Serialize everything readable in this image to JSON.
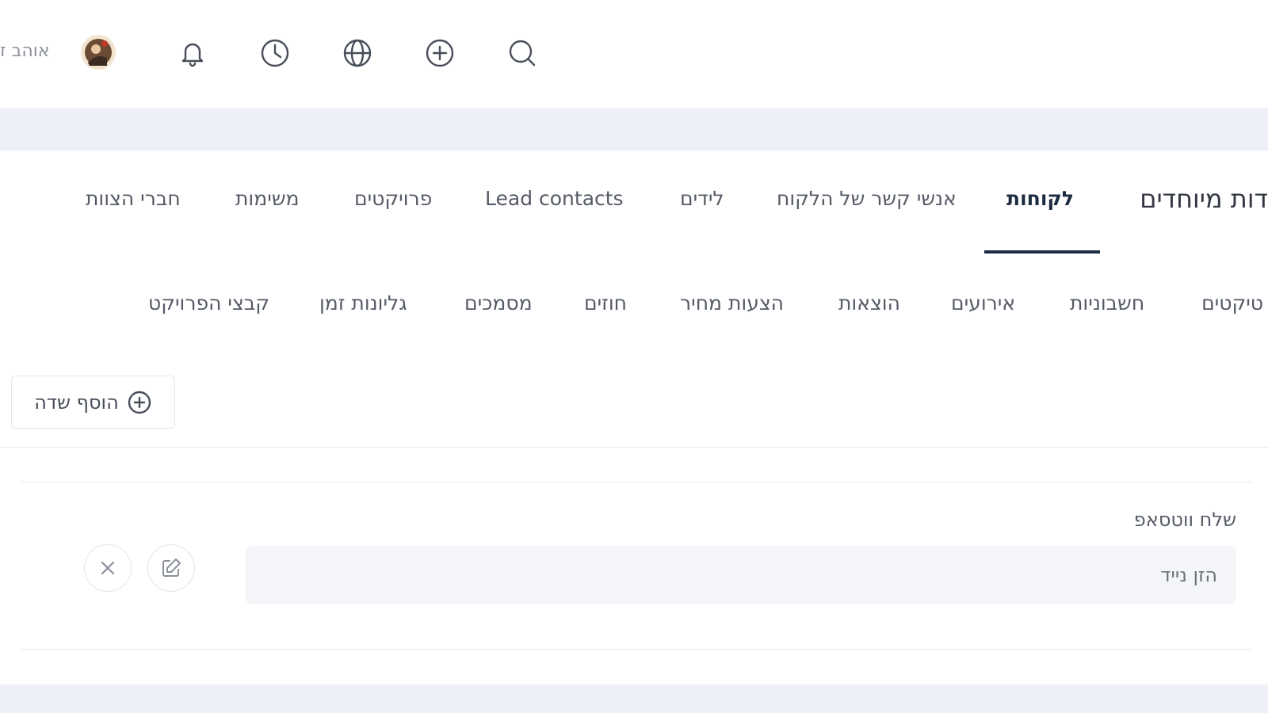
{
  "topbar": {
    "user_name": "אוהב ז",
    "icons": [
      "bell-icon",
      "clock-icon",
      "globe-icon",
      "plus-circle-icon",
      "search-icon"
    ]
  },
  "nav": {
    "tabs_row1": [
      {
        "label": "דות מיוחדים",
        "kind": "heading"
      },
      {
        "label": "לקוחות",
        "active": true
      },
      {
        "label": "אנשי קשר של הלקוח"
      },
      {
        "label": "לידים"
      },
      {
        "label": "Lead contacts"
      },
      {
        "label": "פרויקטים"
      },
      {
        "label": "משימות"
      },
      {
        "label": "חברי הצוות"
      }
    ],
    "tabs_row2": [
      {
        "label": "טיקטים"
      },
      {
        "label": "חשבוניות"
      },
      {
        "label": "אירועים"
      },
      {
        "label": "הוצאות"
      },
      {
        "label": "הצעות מחיר"
      },
      {
        "label": "חוזים"
      },
      {
        "label": "מסמכים"
      },
      {
        "label": "גליונות זמן"
      },
      {
        "label": "קבצי הפרויקט"
      }
    ]
  },
  "actions": {
    "add_field_label": "הוסף שדה"
  },
  "custom_field": {
    "label": "שלח ווטסאפ",
    "placeholder": "הזן נייד"
  },
  "colors": {
    "active_tab": "#1c2b41",
    "page_band": "#eef0f8",
    "input_bg": "#f4f5f8"
  }
}
